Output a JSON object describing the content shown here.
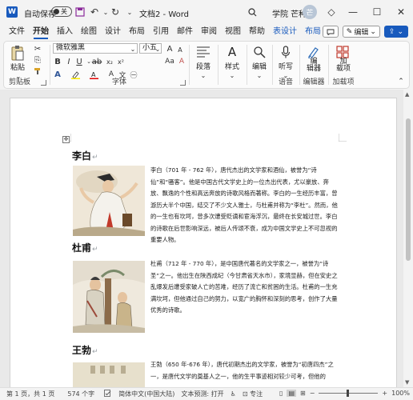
{
  "titlebar": {
    "autosave_label": "自动保存",
    "autosave_state": "关",
    "doc_title": "文档2 - Word",
    "user_name": "学院 芒种",
    "user_initial": "芒"
  },
  "menu": {
    "items": [
      "文件",
      "开始",
      "插入",
      "绘图",
      "设计",
      "布局",
      "引用",
      "邮件",
      "审阅",
      "视图",
      "帮助",
      "表设计",
      "布局"
    ],
    "active_index": 1,
    "edit_label": "编辑",
    "share_icon": "share-icon"
  },
  "ribbon": {
    "paste_label": "粘贴",
    "clipboard_group": "剪贴板",
    "font_name": "微软雅黑",
    "font_size": "小五",
    "font_group": "字体",
    "paragraph_label": "段落",
    "style_label": "样式",
    "editing_label": "编辑",
    "dictate_label": "听写",
    "voice_group": "语音",
    "editor_label": "编\n辑器",
    "editor_group": "编辑器",
    "addins_label": "加\n载项",
    "addins_group": "加载项"
  },
  "document": {
    "poets": [
      {
        "name": "李白",
        "text": "李白（701 年 - 762 年），唐代杰出的文学家和酒仙，被誉为“诗仙”和“骚客”。他是中国古代文学史上的一位杰出代表，尤以豪放、奔放、飘逸的个性和高远奔放的诗歌风格而著称。李白的一生经历丰富，曾游历大半个中国，结交了不少文人雅士，与杜甫并称为“李杜”。然而，他的一生也有坎坷，曾多次遭受贬谪和宦海浮沉，最终在长安城过世。李白的诗歌在后世影响深远，被后人传颂不衰，成为中国文学史上不可忽视的重要人物。"
      },
      {
        "name": "杜甫",
        "text": "杜甫（712 年 - 770 年），是中国唐代著名的文学家之一，被誉为“诗圣”之一。他出生在陕西成纪（今甘肃省天水市），家境显赫，但在安史之乱爆发后遭受家破人亡的苦难，经历了流亡和贫困的生活。杜甫的一生充满坎坷，但他通过自己的努力，以宽广的胸怀和深刻的思考，创作了大量优秀的诗歌。"
      },
      {
        "name": "王勃",
        "text": "王勃（650 年-676 年），唐代初期杰出的文学家，被誉为“初唐四杰”之一，是唐代文学的奠基人之一，他的生平事迹相对较少可考，但他的"
      }
    ]
  },
  "statusbar": {
    "page": "第 1 页，共 1 页",
    "words": "574 个字",
    "language": "简体中文(中国大陆)",
    "prediction": "文本预测: 打开",
    "focus": "专注",
    "zoom": "100%",
    "zoom_minus": "−",
    "zoom_plus": "+"
  }
}
